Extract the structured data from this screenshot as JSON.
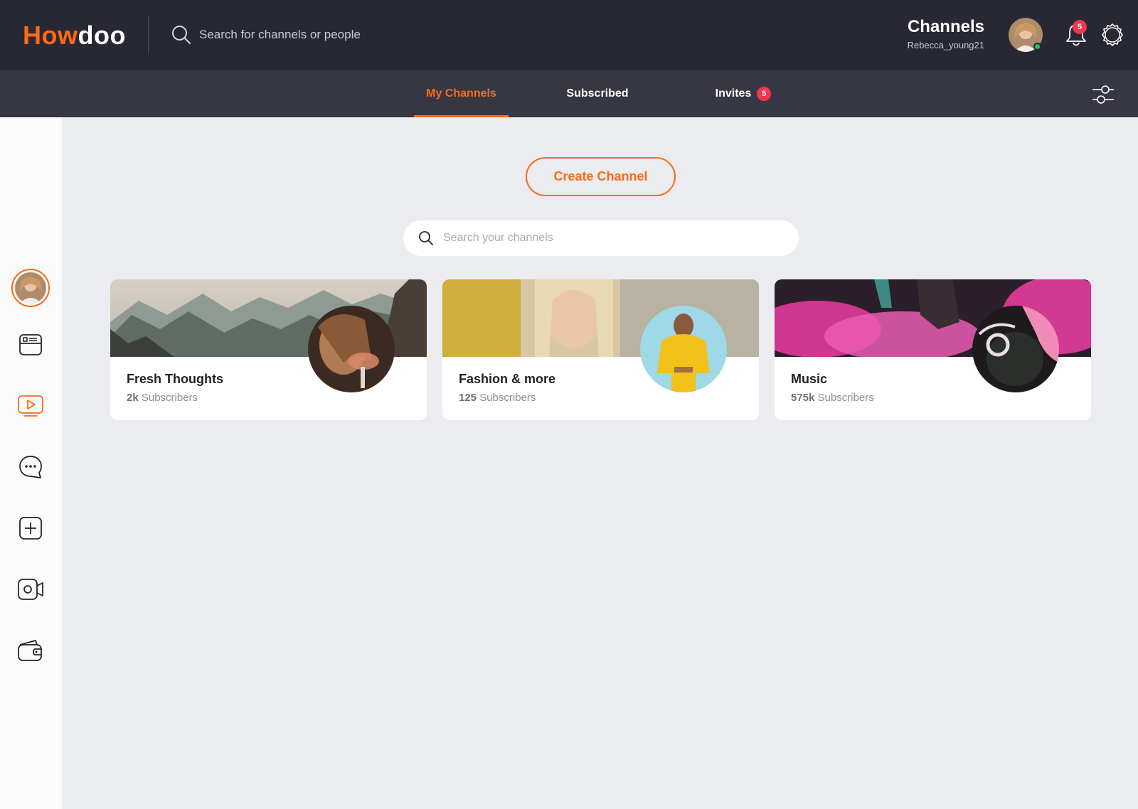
{
  "app": {
    "logo_how": "How",
    "logo_doo": "doo",
    "brand_color": "#ff6a13"
  },
  "top_search": {
    "placeholder": "Search for channels or people"
  },
  "header": {
    "title": "Channels",
    "username": "Rebecca_young21"
  },
  "notifications": {
    "count": "5"
  },
  "tabs": [
    {
      "label": "My Channels",
      "active": true
    },
    {
      "label": "Subscribed",
      "active": false
    },
    {
      "label": "Invites",
      "badge": "5",
      "active": false
    }
  ],
  "sidebar": {
    "items": [
      {
        "icon": "profile-avatar"
      },
      {
        "icon": "news-feed-icon"
      },
      {
        "icon": "channels-play-icon",
        "active": true
      },
      {
        "icon": "chat-bubble-icon"
      },
      {
        "icon": "add-post-icon"
      },
      {
        "icon": "video-camera-icon"
      },
      {
        "icon": "wallet-icon"
      }
    ]
  },
  "main": {
    "create_label": "Create Channel",
    "search_placeholder": "Search your channels",
    "channels": [
      {
        "name": "Fresh Thoughts",
        "count": "2k",
        "count_suffix": "Subscribers"
      },
      {
        "name": "Fashion & more",
        "count": "125",
        "count_suffix": "Subscribers"
      },
      {
        "name": "Music",
        "count": "575k",
        "count_suffix": "Subscribers"
      }
    ]
  }
}
